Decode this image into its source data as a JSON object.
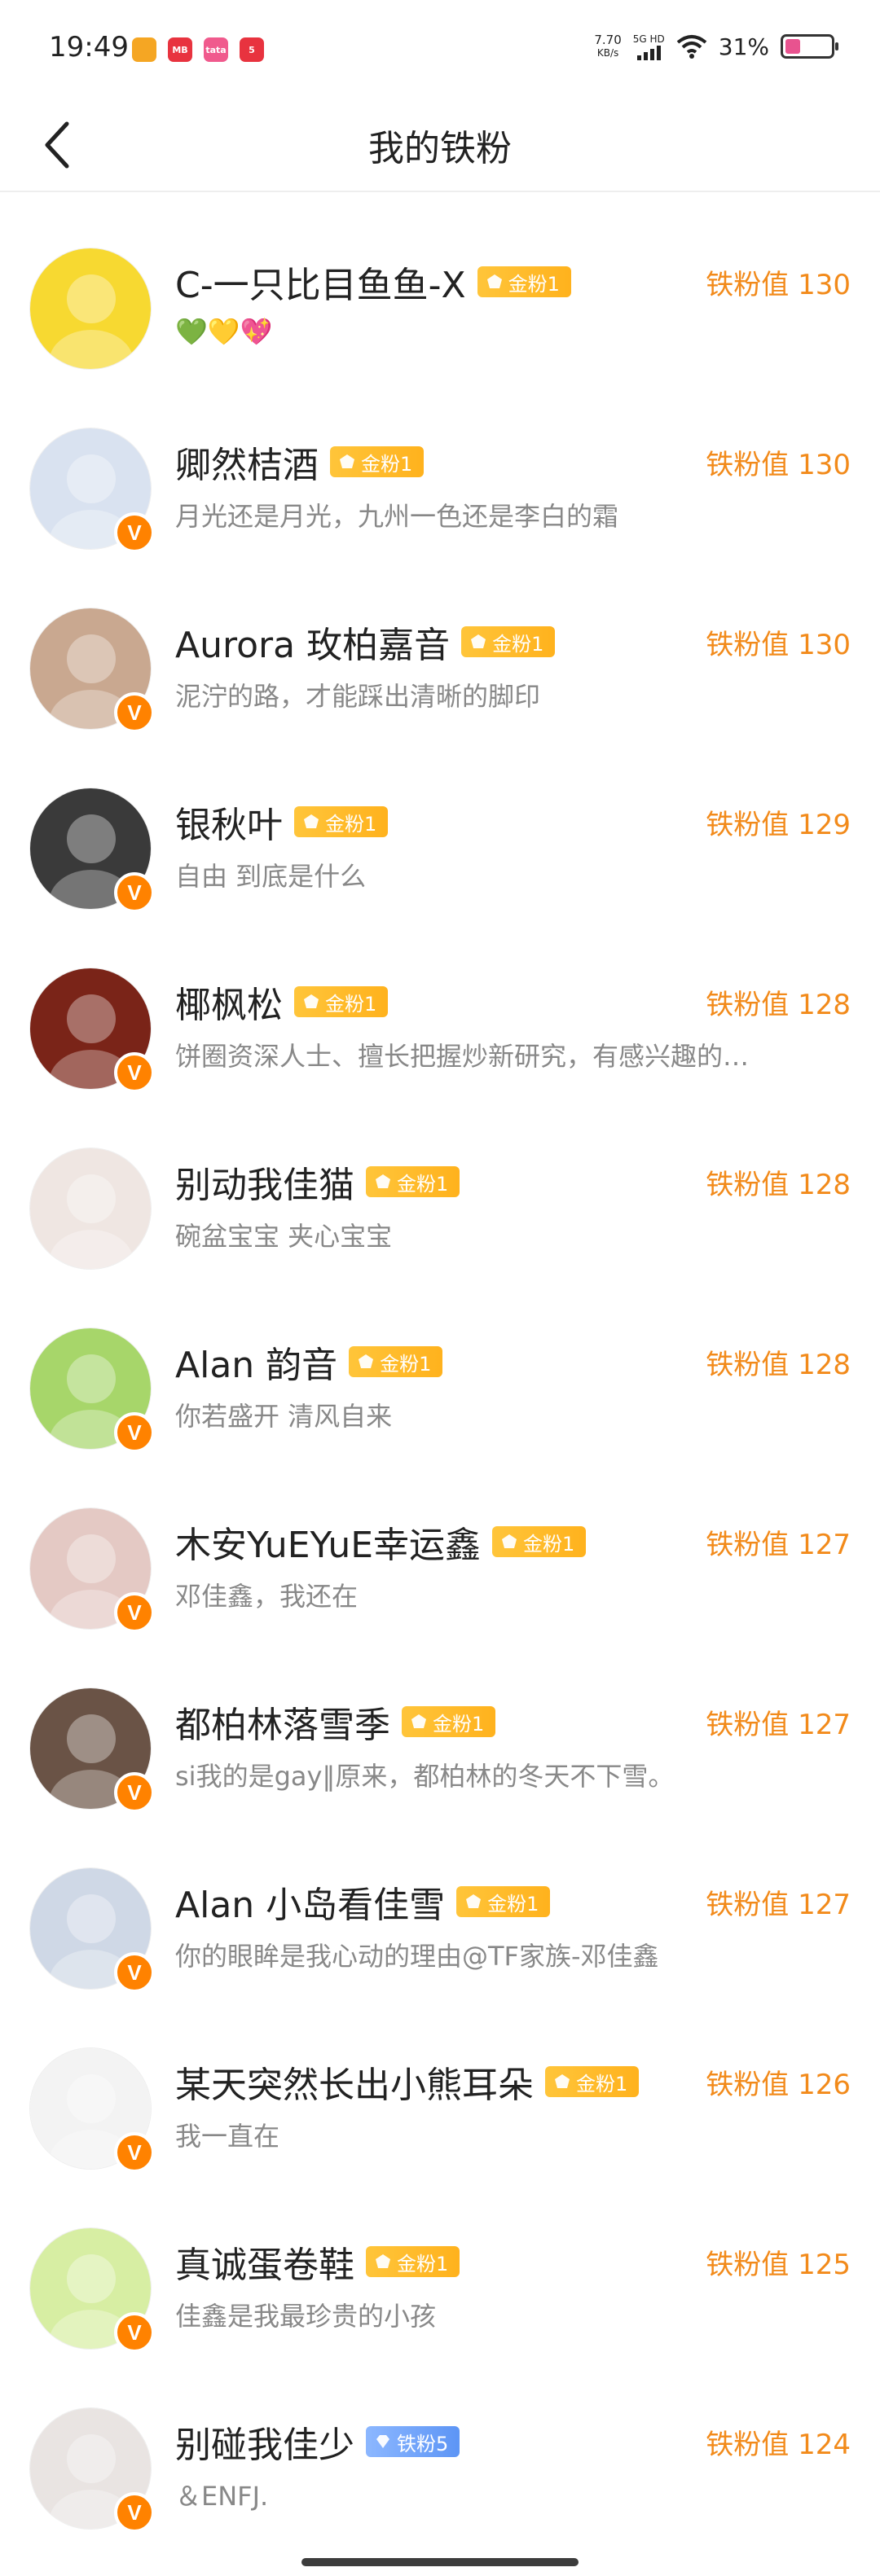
{
  "status_bar": {
    "time": "19:49",
    "net_speed": "7.70",
    "net_unit": "KB/s",
    "net_type": "5G HD",
    "battery": "31%",
    "apps": [
      {
        "icon": "weibo-app-icon",
        "color": "#f5a623",
        "label": ""
      },
      {
        "icon": "app-icon-red",
        "color": "#e8333f",
        "label": "MB"
      },
      {
        "icon": "app-icon-pink",
        "color": "#f05a8d",
        "label": "tata"
      },
      {
        "icon": "app-icon-red2",
        "color": "#e8333f",
        "label": "5"
      }
    ]
  },
  "nav": {
    "title": "我的铁粉"
  },
  "fans": [
    {
      "name": "C-一只比目鱼鱼-X",
      "badge": "金粉1",
      "badge_type": "gold",
      "bio": "💚💛💖",
      "score_label": "铁粉值 130",
      "verified": false,
      "avatar_color": "#f7d931",
      "avatar_icon": "yellow-lion-avatar"
    },
    {
      "name": "卿然桔酒",
      "badge": "金粉1",
      "badge_type": "gold",
      "bio": "月光还是月光，九州一色还是李白的霜",
      "score_label": "铁粉值 130",
      "verified": true,
      "avatar_color": "#d9e2f0",
      "avatar_icon": "anime-boy-avatar"
    },
    {
      "name": "Aurora  玫柏嘉音",
      "badge": "金粉1",
      "badge_type": "gold",
      "bio": "泥泞的路，才能踩出清晰的脚印",
      "score_label": "铁粉值 130",
      "verified": true,
      "avatar_color": "#c9a890",
      "avatar_icon": "girl-avatar"
    },
    {
      "name": "银秋叶",
      "badge": "金粉1",
      "badge_type": "gold",
      "bio": "自由 到底是什么",
      "score_label": "铁粉值 129",
      "verified": true,
      "avatar_color": "#3a3a3a",
      "avatar_icon": "hooded-avatar"
    },
    {
      "name": "椰枫松",
      "badge": "金粉1",
      "badge_type": "gold",
      "bio": "饼圈资深人士、擅长把握炒新研究，有感兴趣的…",
      "score_label": "铁粉值 128",
      "verified": true,
      "avatar_color": "#7a2418",
      "avatar_icon": "anime-fire-avatar"
    },
    {
      "name": "别动我佳猫",
      "badge": "金粉1",
      "badge_type": "gold",
      "bio": "碗盆宝宝 夹心宝宝",
      "score_label": "铁粉值 128",
      "verified": false,
      "avatar_color": "#efe6e2",
      "avatar_icon": "suit-boy-avatar"
    },
    {
      "name": "Alan  韵音",
      "badge": "金粉1",
      "badge_type": "gold",
      "bio": "你若盛开 清风自来",
      "score_label": "铁粉值 128",
      "verified": true,
      "avatar_color": "#a7d66a",
      "avatar_icon": "green-sticker-avatar"
    },
    {
      "name": "木安YuEYuE幸运鑫",
      "badge": "金粉1",
      "badge_type": "gold",
      "bio": "邓佳鑫，我还在",
      "score_label": "铁粉值 127",
      "verified": true,
      "avatar_color": "#e4c9c4",
      "avatar_icon": "girl-closeup-avatar"
    },
    {
      "name": "都柏林落雪季",
      "badge": "金粉1",
      "badge_type": "gold",
      "bio": "si我的是gay‖原来，都柏林的冬天不下雪。",
      "score_label": "铁粉值 127",
      "verified": true,
      "avatar_color": "#6a5346",
      "avatar_icon": "girl-longhair-avatar"
    },
    {
      "name": "Alan  小岛看佳雪",
      "badge": "金粉1",
      "badge_type": "gold",
      "bio": "你的眼眸是我心动的理由@TF家族-邓佳鑫",
      "score_label": "铁粉值 127",
      "verified": true,
      "avatar_color": "#cfd8e6",
      "avatar_icon": "girl-doll-avatar"
    },
    {
      "name": "某天突然长出小熊耳朵",
      "badge": "金粉1",
      "badge_type": "gold",
      "bio": "我一直在",
      "score_label": "铁粉值 126",
      "verified": true,
      "avatar_color": "#f3f3f3",
      "avatar_icon": "cake-avatar"
    },
    {
      "name": "真诚蛋卷鞋",
      "badge": "金粉1",
      "badge_type": "gold",
      "bio": "佳鑫是我最珍贵的小孩",
      "score_label": "铁粉值 125",
      "verified": true,
      "avatar_color": "#d7eea3",
      "avatar_icon": "green-hair-avatar"
    },
    {
      "name": "别碰我佳少",
      "badge": "铁粉5",
      "badge_type": "blue",
      "bio": "＆ENFJ.",
      "score_label": "铁粉值 124",
      "verified": true,
      "avatar_color": "#e9e4e2",
      "avatar_icon": "girl-portrait-avatar"
    }
  ]
}
